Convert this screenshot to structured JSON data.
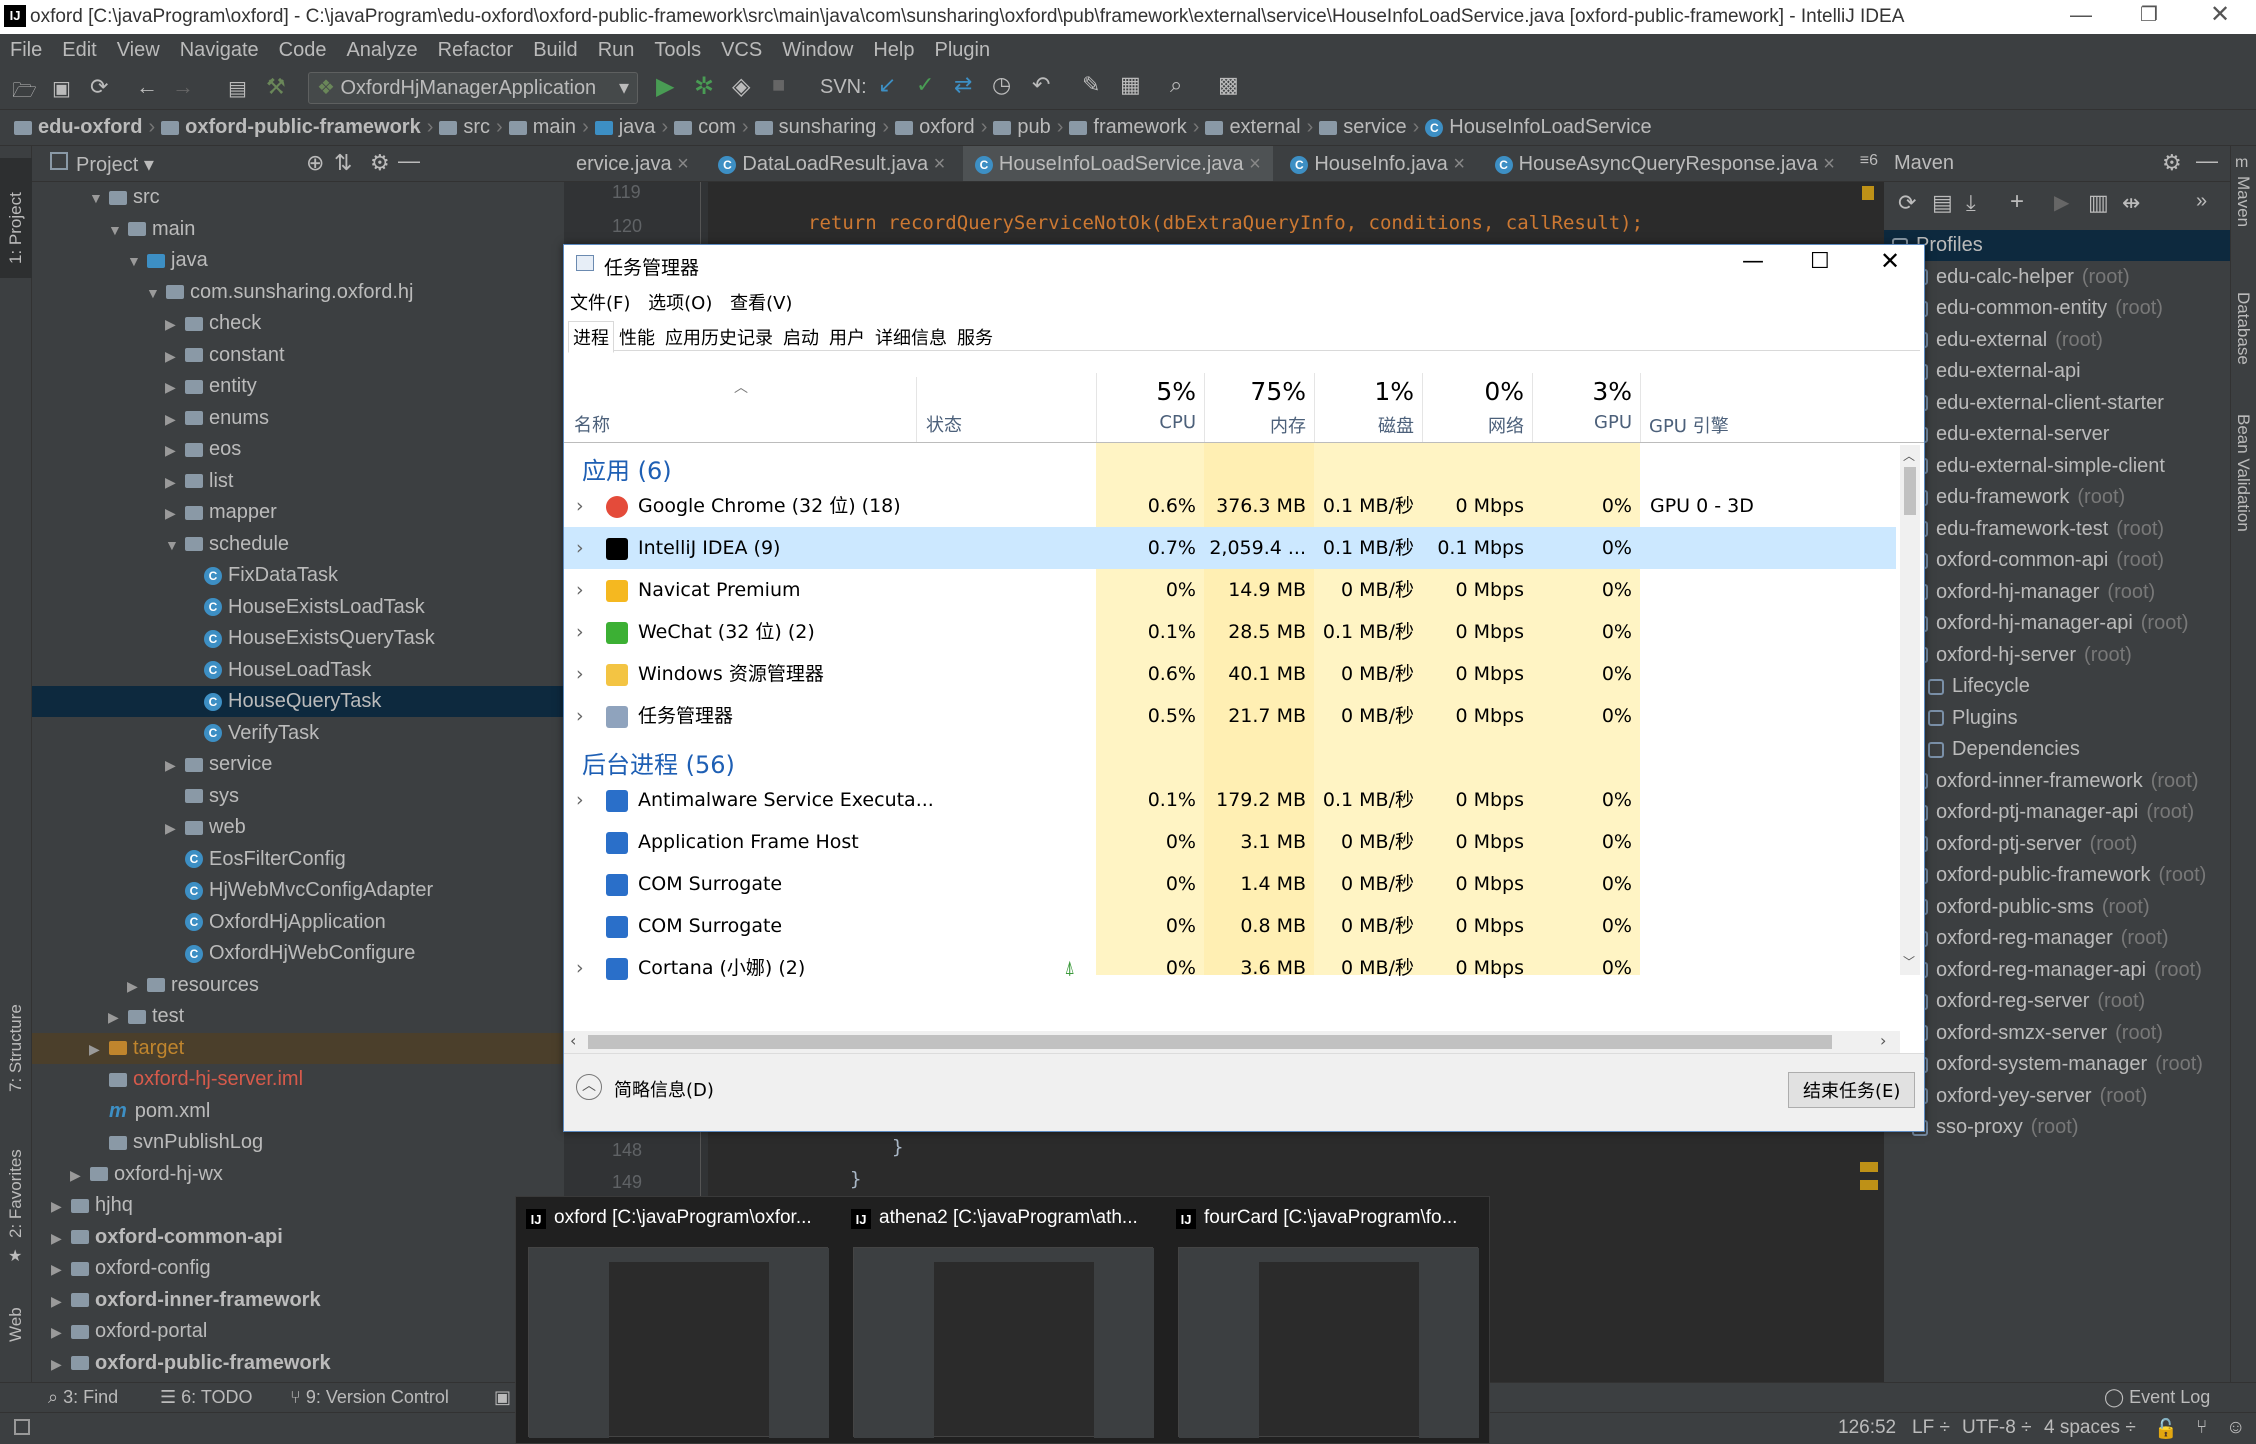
{
  "window_title": "oxford [C:\\javaProgram\\oxford] - C:\\javaProgram\\edu-oxford\\oxford-public-framework\\src\\main\\java\\com\\sunsharing\\oxford\\pub\\framework\\external\\service\\HouseInfoLoadService.java [oxford-public-framework] - IntelliJ IDEA",
  "menu": [
    "File",
    "Edit",
    "View",
    "Navigate",
    "Code",
    "Analyze",
    "Refactor",
    "Build",
    "Run",
    "Tools",
    "VCS",
    "Window",
    "Help",
    "Plugin"
  ],
  "toolbar": {
    "run_config": "OxfordHjManagerApplication",
    "svn_label": "SVN:"
  },
  "breadcrumb": [
    "edu-oxford",
    "oxford-public-framework",
    "src",
    "main",
    "java",
    "com",
    "sunsharing",
    "oxford",
    "pub",
    "framework",
    "external",
    "service",
    "HouseInfoLoadService"
  ],
  "left_strip": {
    "project": "1: Project",
    "structure": "7: Structure",
    "favorites": "2: Favorites",
    "web": "Web"
  },
  "project_panel": {
    "title": "Project"
  },
  "tree": [
    {
      "label": "src",
      "depth": 3,
      "arrow": "▼",
      "type": "folder"
    },
    {
      "label": "main",
      "depth": 4,
      "arrow": "▼",
      "type": "folder"
    },
    {
      "label": "java",
      "depth": 5,
      "arrow": "▼",
      "type": "folder-blue"
    },
    {
      "label": "com.sunsharing.oxford.hj",
      "depth": 6,
      "arrow": "▼",
      "type": "package"
    },
    {
      "label": "check",
      "depth": 7,
      "arrow": "▶",
      "type": "package"
    },
    {
      "label": "constant",
      "depth": 7,
      "arrow": "▶",
      "type": "package"
    },
    {
      "label": "entity",
      "depth": 7,
      "arrow": "▶",
      "type": "package"
    },
    {
      "label": "enums",
      "depth": 7,
      "arrow": "▶",
      "type": "package"
    },
    {
      "label": "eos",
      "depth": 7,
      "arrow": "▶",
      "type": "package"
    },
    {
      "label": "list",
      "depth": 7,
      "arrow": "▶",
      "type": "package"
    },
    {
      "label": "mapper",
      "depth": 7,
      "arrow": "▶",
      "type": "package"
    },
    {
      "label": "schedule",
      "depth": 7,
      "arrow": "▼",
      "type": "package"
    },
    {
      "label": "FixDataTask",
      "depth": 8,
      "arrow": "",
      "type": "class"
    },
    {
      "label": "HouseExistsLoadTask",
      "depth": 8,
      "arrow": "",
      "type": "class"
    },
    {
      "label": "HouseExistsQueryTask",
      "depth": 8,
      "arrow": "",
      "type": "class"
    },
    {
      "label": "HouseLoadTask",
      "depth": 8,
      "arrow": "",
      "type": "class"
    },
    {
      "label": "HouseQueryTask",
      "depth": 8,
      "arrow": "",
      "type": "class",
      "selected": true
    },
    {
      "label": "VerifyTask",
      "depth": 8,
      "arrow": "",
      "type": "class"
    },
    {
      "label": "service",
      "depth": 7,
      "arrow": "▶",
      "type": "package"
    },
    {
      "label": "sys",
      "depth": 7,
      "arrow": "",
      "type": "package"
    },
    {
      "label": "web",
      "depth": 7,
      "arrow": "▶",
      "type": "package"
    },
    {
      "label": "EosFilterConfig",
      "depth": 7,
      "arrow": "",
      "type": "class"
    },
    {
      "label": "HjWebMvcConfigAdapter",
      "depth": 7,
      "arrow": "",
      "type": "class"
    },
    {
      "label": "OxfordHjApplication",
      "depth": 7,
      "arrow": "",
      "type": "class"
    },
    {
      "label": "OxfordHjWebConfigure",
      "depth": 7,
      "arrow": "",
      "type": "class"
    },
    {
      "label": "resources",
      "depth": 5,
      "arrow": "▶",
      "type": "folder"
    },
    {
      "label": "test",
      "depth": 4,
      "arrow": "▶",
      "type": "folder"
    },
    {
      "label": "target",
      "depth": 3,
      "arrow": "▶",
      "type": "folder-orange",
      "target": true
    },
    {
      "label": "oxford-hj-server.iml",
      "depth": 3,
      "arrow": "",
      "type": "file",
      "red": true
    },
    {
      "label": "pom.xml",
      "depth": 3,
      "arrow": "",
      "type": "maven"
    },
    {
      "label": "svnPublishLog",
      "depth": 3,
      "arrow": "",
      "type": "folder"
    },
    {
      "label": "oxford-hj-wx",
      "depth": 2,
      "arrow": "▶",
      "type": "folder"
    },
    {
      "label": "hjhq",
      "depth": 1,
      "arrow": "▶",
      "type": "folder"
    },
    {
      "label": "oxford-common-api",
      "depth": 1,
      "arrow": "▶",
      "type": "module",
      "bold": true
    },
    {
      "label": "oxford-config",
      "depth": 1,
      "arrow": "▶",
      "type": "folder"
    },
    {
      "label": "oxford-inner-framework",
      "depth": 1,
      "arrow": "▶",
      "type": "module",
      "bold": true
    },
    {
      "label": "oxford-portal",
      "depth": 1,
      "arrow": "▶",
      "type": "folder"
    },
    {
      "label": "oxford-public-framework",
      "depth": 1,
      "arrow": "▶",
      "type": "module",
      "bold": true
    }
  ],
  "editor_tabs": [
    {
      "label": "ervice.java",
      "active": false
    },
    {
      "label": "DataLoadResult.java",
      "active": false
    },
    {
      "label": "HouseInfoLoadService.java",
      "active": true
    },
    {
      "label": "HouseInfo.java",
      "active": false
    },
    {
      "label": "HouseAsyncQueryResponse.java",
      "active": false
    }
  ],
  "editor_tabs_more": "≡6",
  "code_lines": [
    {
      "num": "119",
      "text": ""
    },
    {
      "num": "120",
      "text": "return recordQueryServiceNotOk(dbExtraQueryInfo, conditions, callResult);"
    },
    {
      "num": "148",
      "text": "}"
    },
    {
      "num": "149",
      "text": "}"
    }
  ],
  "maven": {
    "title": "Maven",
    "items": [
      {
        "label": "Profiles",
        "root": "",
        "type": "folder",
        "selected": true
      },
      {
        "label": "edu-calc-helper",
        "root": "(root)"
      },
      {
        "label": "edu-common-entity",
        "root": "(root)"
      },
      {
        "label": "edu-external",
        "root": "(root)"
      },
      {
        "label": "edu-external-api",
        "root": ""
      },
      {
        "label": "edu-external-client-starter",
        "root": ""
      },
      {
        "label": "edu-external-server",
        "root": ""
      },
      {
        "label": "edu-external-simple-client",
        "root": ""
      },
      {
        "label": "edu-framework",
        "root": "(root)"
      },
      {
        "label": "edu-framework-test",
        "root": "(root)"
      },
      {
        "label": "oxford-common-api",
        "root": "(root)"
      },
      {
        "label": "oxford-hj-manager",
        "root": "(root)"
      },
      {
        "label": "oxford-hj-manager-api",
        "root": "(root)"
      },
      {
        "label": "oxford-hj-server",
        "root": "(root)"
      },
      {
        "label": "Lifecycle",
        "root": "",
        "sub": true
      },
      {
        "label": "Plugins",
        "root": "",
        "sub": true
      },
      {
        "label": "Dependencies",
        "root": "",
        "sub": true
      },
      {
        "label": "oxford-inner-framework",
        "root": "(root)"
      },
      {
        "label": "oxford-ptj-manager-api",
        "root": "(root)"
      },
      {
        "label": "oxford-ptj-server",
        "root": "(root)"
      },
      {
        "label": "oxford-public-framework",
        "root": "(root)"
      },
      {
        "label": "oxford-public-sms",
        "root": "(root)"
      },
      {
        "label": "oxford-reg-manager",
        "root": "(root)"
      },
      {
        "label": "oxford-reg-manager-api",
        "root": "(root)"
      },
      {
        "label": "oxford-reg-server",
        "root": "(root)"
      },
      {
        "label": "oxford-smzx-server",
        "root": "(root)"
      },
      {
        "label": "oxford-system-manager",
        "root": "(root)"
      },
      {
        "label": "oxford-yey-server",
        "root": "(root)"
      },
      {
        "label": "sso-proxy",
        "root": "(root)"
      }
    ]
  },
  "right_strip": {
    "maven": "Maven",
    "database": "Database",
    "bean": "Bean Validation"
  },
  "bottom_tools": [
    "3: Find",
    "6: TODO",
    "9: Version Control"
  ],
  "event_log": "Event Log",
  "status": {
    "position": "126:52",
    "line_sep": "LF",
    "encoding": "UTF-8",
    "indent": "4 spaces"
  },
  "task_manager": {
    "title": "任务管理器",
    "menu": [
      "文件(F)",
      "选项(O)",
      "查看(V)"
    ],
    "tabs": [
      "进程",
      "性能",
      "应用历史记录",
      "启动",
      "用户",
      "详细信息",
      "服务"
    ],
    "columns": {
      "name": "名称",
      "status": "状态",
      "cpu": {
        "pct": "5%",
        "label": "CPU"
      },
      "mem": {
        "pct": "75%",
        "label": "内存"
      },
      "disk": {
        "pct": "1%",
        "label": "磁盘"
      },
      "net": {
        "pct": "0%",
        "label": "网络"
      },
      "gpu": {
        "pct": "3%",
        "label": "GPU"
      },
      "gpu_engine": "GPU 引擎"
    },
    "groups": {
      "apps": "应用 (6)",
      "background": "后台进程 (56)"
    },
    "apps": [
      {
        "name": "Google Chrome (32 位) (18)",
        "cpu": "0.6%",
        "mem": "376.3 MB",
        "disk": "0.1 MB/秒",
        "net": "0 Mbps",
        "gpu": "0%",
        "engine": "GPU 0 - 3D",
        "icon": "chrome",
        "expand": true
      },
      {
        "name": "IntelliJ IDEA (9)",
        "cpu": "0.7%",
        "mem": "2,059.4 ...",
        "disk": "0.1 MB/秒",
        "net": "0.1 Mbps",
        "gpu": "0%",
        "engine": "",
        "icon": "idea",
        "expand": true,
        "selected": true
      },
      {
        "name": "Navicat Premium",
        "cpu": "0%",
        "mem": "14.9 MB",
        "disk": "0 MB/秒",
        "net": "0 Mbps",
        "gpu": "0%",
        "engine": "",
        "icon": "navicat",
        "expand": true
      },
      {
        "name": "WeChat (32 位) (2)",
        "cpu": "0.1%",
        "mem": "28.5 MB",
        "disk": "0.1 MB/秒",
        "net": "0 Mbps",
        "gpu": "0%",
        "engine": "",
        "icon": "wechat",
        "expand": true
      },
      {
        "name": "Windows 资源管理器",
        "cpu": "0.6%",
        "mem": "40.1 MB",
        "disk": "0 MB/秒",
        "net": "0 Mbps",
        "gpu": "0%",
        "engine": "",
        "icon": "explorer",
        "expand": true
      },
      {
        "name": "任务管理器",
        "cpu": "0.5%",
        "mem": "21.7 MB",
        "disk": "0 MB/秒",
        "net": "0 Mbps",
        "gpu": "0%",
        "engine": "",
        "icon": "taskmgr",
        "expand": true
      }
    ],
    "background": [
      {
        "name": "Antimalware Service Executa...",
        "cpu": "0.1%",
        "mem": "179.2 MB",
        "disk": "0.1 MB/秒",
        "net": "0 Mbps",
        "gpu": "0%",
        "expand": true
      },
      {
        "name": "Application Frame Host",
        "cpu": "0%",
        "mem": "3.1 MB",
        "disk": "0 MB/秒",
        "net": "0 Mbps",
        "gpu": "0%",
        "expand": false
      },
      {
        "name": "COM Surrogate",
        "cpu": "0%",
        "mem": "1.4 MB",
        "disk": "0 MB/秒",
        "net": "0 Mbps",
        "gpu": "0%",
        "expand": false
      },
      {
        "name": "COM Surrogate",
        "cpu": "0%",
        "mem": "0.8 MB",
        "disk": "0 MB/秒",
        "net": "0 Mbps",
        "gpu": "0%",
        "expand": false
      },
      {
        "name": "Cortana (小娜) (2)",
        "cpu": "0%",
        "mem": "3.6 MB",
        "disk": "0 MB/秒",
        "net": "0 Mbps",
        "gpu": "0%",
        "expand": true,
        "leaf": true
      }
    ],
    "fewer_details": "简略信息(D)",
    "end_task": "结束任务(E)"
  },
  "taskbar_preview": [
    {
      "title": "oxford [C:\\javaProgram\\oxfor..."
    },
    {
      "title": "athena2 [C:\\javaProgram\\ath..."
    },
    {
      "title": "fourCard [C:\\javaProgram\\fo..."
    }
  ]
}
